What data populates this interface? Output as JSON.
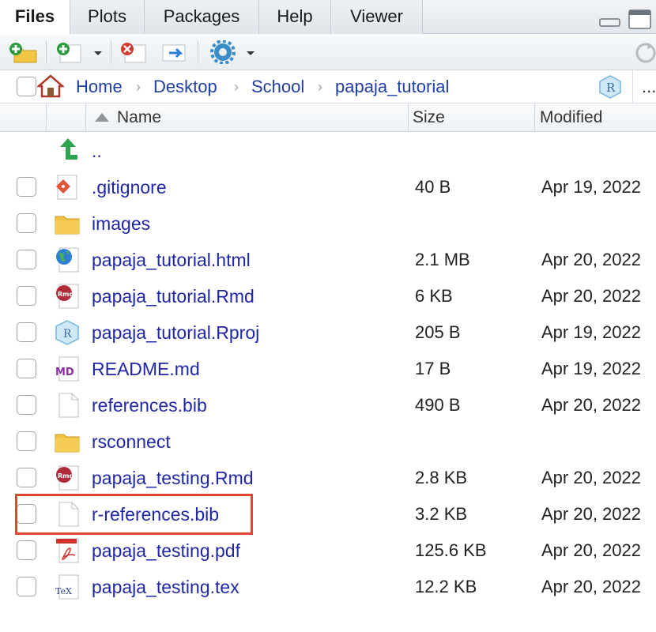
{
  "tabs": [
    {
      "label": "Files",
      "active": true
    },
    {
      "label": "Plots",
      "active": false
    },
    {
      "label": "Packages",
      "active": false
    },
    {
      "label": "Help",
      "active": false
    },
    {
      "label": "Viewer",
      "active": false
    }
  ],
  "toolbar": {
    "icons": [
      "new-folder-icon",
      "new-file-icon",
      "delete-icon",
      "rename-icon",
      "more-gear-icon",
      "refresh-icon"
    ]
  },
  "breadcrumb": {
    "items": [
      "Home",
      "Desktop",
      "School",
      "papaja_tutorial"
    ],
    "overflow": "..."
  },
  "columns": {
    "name": "Name",
    "size": "Size",
    "modified": "Modified",
    "sort_indicator": "ascending"
  },
  "parent_row": {
    "label": ".."
  },
  "files": [
    {
      "name": ".gitignore",
      "size": "40 B",
      "modified": "Apr 19, 2022",
      "icon": "git-file-icon"
    },
    {
      "name": "images",
      "size": "",
      "modified": "",
      "icon": "folder-icon"
    },
    {
      "name": "papaja_tutorial.html",
      "size": "2.1 MB",
      "modified": "Apr 20, 2022",
      "icon": "html-globe-icon"
    },
    {
      "name": "papaja_tutorial.Rmd",
      "size": "6 KB",
      "modified": "Apr 20, 2022",
      "icon": "rmd-file-icon"
    },
    {
      "name": "papaja_tutorial.Rproj",
      "size": "205 B",
      "modified": "Apr 19, 2022",
      "icon": "rproj-file-icon"
    },
    {
      "name": "README.md",
      "size": "17 B",
      "modified": "Apr 19, 2022",
      "icon": "markdown-file-icon"
    },
    {
      "name": "references.bib",
      "size": "490 B",
      "modified": "Apr 20, 2022",
      "icon": "text-file-icon"
    },
    {
      "name": "rsconnect",
      "size": "",
      "modified": "",
      "icon": "folder-icon"
    },
    {
      "name": "papaja_testing.Rmd",
      "size": "2.8 KB",
      "modified": "Apr 20, 2022",
      "icon": "rmd-file-icon"
    },
    {
      "name": "r-references.bib",
      "size": "3.2 KB",
      "modified": "Apr 20, 2022",
      "icon": "text-file-icon",
      "highlighted": true
    },
    {
      "name": "papaja_testing.pdf",
      "size": "125.6 KB",
      "modified": "Apr 20, 2022",
      "icon": "pdf-file-icon"
    },
    {
      "name": "papaja_testing.tex",
      "size": "12.2 KB",
      "modified": "Apr 20, 2022",
      "icon": "tex-file-icon"
    }
  ],
  "colors": {
    "link": "#1f27a8",
    "breadcrumb": "#1f3fa6",
    "highlight": "#e04530",
    "folder": "#f2c443"
  }
}
